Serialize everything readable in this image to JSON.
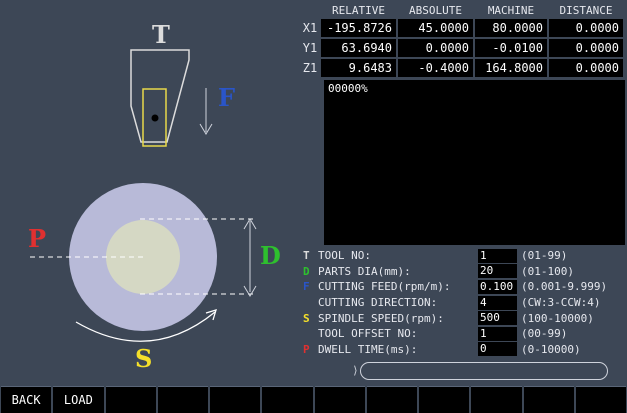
{
  "colors": {
    "background": "#3d4756",
    "panel": "#000000",
    "t_color": "#dcdcdc",
    "f_color": "#2a55c8",
    "p_color": "#e03030",
    "d_color": "#2ec02e",
    "s_color": "#f5e02a",
    "workpiece_outer": "#b8bad8",
    "workpiece_inner": "#d5d8c4"
  },
  "diagram": {
    "t_label": "T",
    "f_label": "F",
    "p_label": "P",
    "d_label": "D",
    "s_label": "S"
  },
  "coords": {
    "headers": [
      "RELATIVE",
      "ABSOLUTE",
      "MACHINE",
      "DISTANCE"
    ],
    "rows": [
      {
        "axis": "X1",
        "values": [
          "-195.8726",
          "45.0000",
          "80.0000",
          "0.0000"
        ]
      },
      {
        "axis": "Y1",
        "values": [
          "63.6940",
          "0.0000",
          "-0.0100",
          "0.0000"
        ]
      },
      {
        "axis": "Z1",
        "values": [
          "9.6483",
          "-0.4000",
          "164.8000",
          "0.0000"
        ]
      }
    ]
  },
  "message": {
    "text": "00000%"
  },
  "params": [
    {
      "letter": "T",
      "letter_color": "#dcdcdc",
      "label": "TOOL NO:",
      "value": "1",
      "range": "(01-99)"
    },
    {
      "letter": "D",
      "letter_color": "#2ec02e",
      "label": "PARTS DIA(mm):",
      "value": "20",
      "range": "(01-100)"
    },
    {
      "letter": "F",
      "letter_color": "#2a55c8",
      "label": "CUTTING FEED(rpm/m):",
      "value": "0.100",
      "range": "(0.001-9.999)"
    },
    {
      "letter": "",
      "letter_color": "#dcdcdc",
      "label": "CUTTING DIRECTION:",
      "value": "4",
      "range": "(CW:3-CCW:4)"
    },
    {
      "letter": "S",
      "letter_color": "#f5e02a",
      "label": "SPINDLE SPEED(rpm):",
      "value": "500",
      "range": "(100-10000)"
    },
    {
      "letter": "",
      "letter_color": "#dcdcdc",
      "label": "TOOL OFFSET NO:",
      "value": "1",
      "range": "(00-99)"
    },
    {
      "letter": "P",
      "letter_color": "#e03030",
      "label": "DWELL TIME(ms):",
      "value": "0",
      "range": "(0-10000)"
    }
  ],
  "softkeys": [
    "BACK",
    "LOAD",
    "",
    "",
    "",
    "",
    "",
    "",
    "",
    "",
    "",
    ""
  ]
}
